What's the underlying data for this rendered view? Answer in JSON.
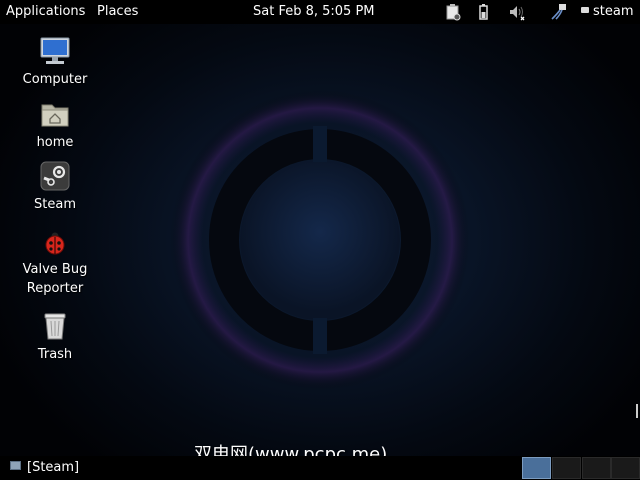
{
  "top_panel": {
    "applications_label": "Applications",
    "places_label": "Places",
    "clock": "Sat Feb  8,  5:05 PM",
    "user_label": "steam",
    "tray_icons": [
      "clipboard-icon",
      "battery-icon",
      "volume-muted-icon",
      "network-icon"
    ]
  },
  "desktop": {
    "icons": [
      {
        "label": "Computer",
        "icon": "computer-icon"
      },
      {
        "label": "home",
        "icon": "home-folder-icon"
      },
      {
        "label": "Steam",
        "icon": "steam-icon"
      },
      {
        "label": "Valve Bug Reporter",
        "icon": "ladybug-icon"
      },
      {
        "label": "Trash",
        "icon": "trash-icon"
      }
    ],
    "wallpaper_logo": "steam-os-ring-logo"
  },
  "bottom_panel": {
    "taskbar_item": "[Steam]",
    "workspaces": 4,
    "active_workspace": 1
  },
  "watermark": "双电网(www.pcpc.me)",
  "colors": {
    "panel_background": "#000000",
    "active_workspace": "#4a6f9a",
    "wallpaper_glow": "#0f1e35"
  }
}
